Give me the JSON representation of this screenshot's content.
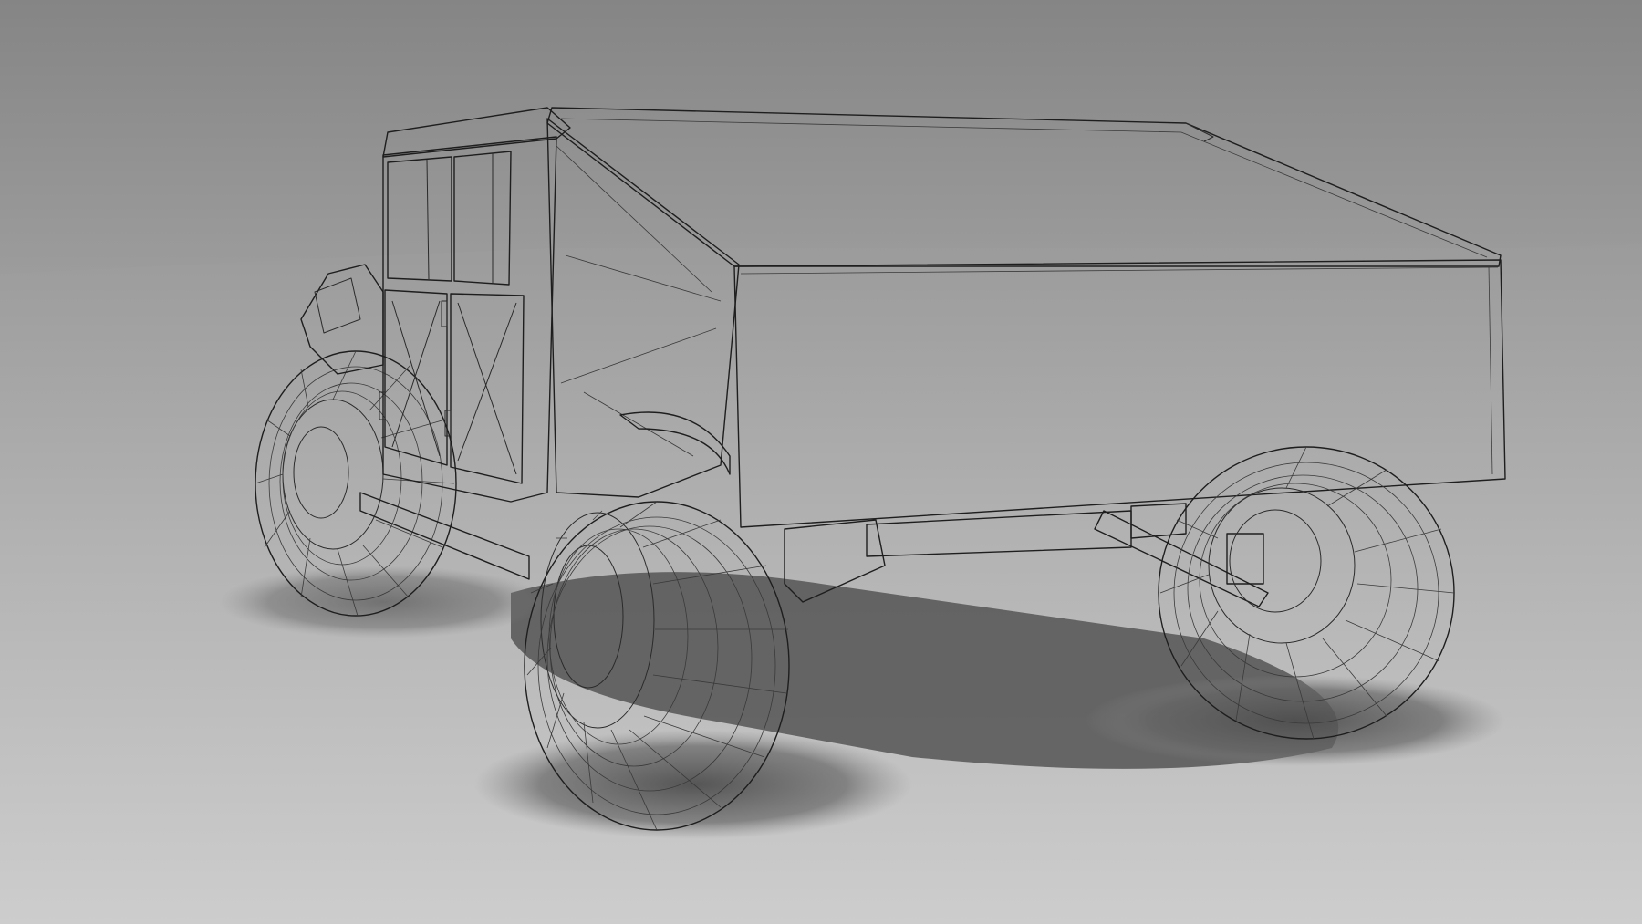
{
  "scene": {
    "subject": "vehicle-wireframe-render",
    "colors": {
      "backdrop": "#8f8f8f",
      "floor_far": "#9a9a9a",
      "floor_near": "#c9c9c9",
      "body": "#e6e6e6",
      "body_shade": "#cfcfcf",
      "tire": "#d9d9d9",
      "wire": "#2a2a2a",
      "shadow": "#5e5e5e"
    }
  }
}
